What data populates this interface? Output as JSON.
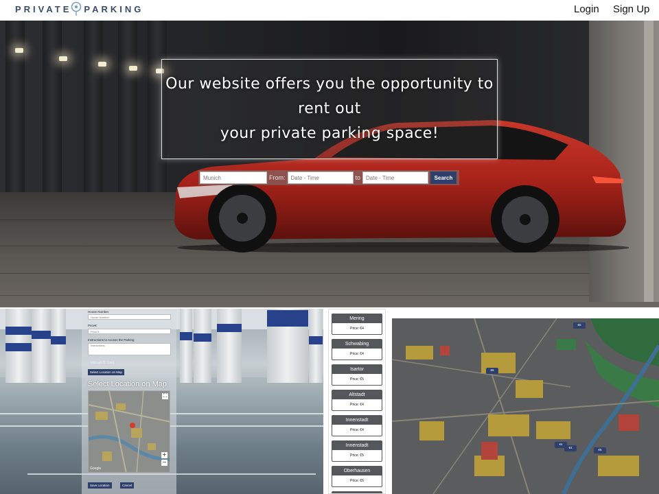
{
  "brand": {
    "left": "PRIVATE",
    "right": "PARKING",
    "logo_icon": "map-pin-icon"
  },
  "nav": {
    "login": "Login",
    "signup": "Sign Up"
  },
  "hero": {
    "line1": "Our website offers you the opportunity to",
    "line2": "rent out",
    "line3": "your private parking space!"
  },
  "search": {
    "location_placeholder": "Munich",
    "from_label": "From:",
    "from_placeholder": "Date - Time",
    "to_label": "to",
    "to_placeholder": "Date - Time",
    "button": "Search"
  },
  "form": {
    "house_number_label": "House Number",
    "house_number_placeholder": "House Number",
    "price_label": "Price€",
    "price_placeholder": "Price €",
    "instructions_label": "Instructions to Access the Parking",
    "instructions_placeholder": "Instructions",
    "upload_label": "Upload ID Card",
    "select_location_button": "Select Location on Map",
    "map_heading": "Select Location on Map",
    "zoom_in": "+",
    "zoom_out": "−",
    "map_attribution": "Google",
    "save_button": "Save Location",
    "cancel_button": "Cancel"
  },
  "listings": [
    {
      "name": "Mering",
      "price": "Price: €4"
    },
    {
      "name": "Schwabing",
      "price": "Price: €4"
    },
    {
      "name": "Isartor",
      "price": "Price: €5"
    },
    {
      "name": "Altstadt",
      "price": "Price: €4"
    },
    {
      "name": "Innenstadt",
      "price": "Price: €4"
    },
    {
      "name": "Innenstadt",
      "price": "Price: €5"
    },
    {
      "name": "Oberhausen",
      "price": "Price: €6"
    }
  ],
  "map_markers": [
    "€6",
    "€6",
    "€4",
    "€4",
    "€5"
  ],
  "colors": {
    "accent": "#2f3f6b",
    "card_header": "#54575b",
    "car_red": "#a8231a"
  }
}
